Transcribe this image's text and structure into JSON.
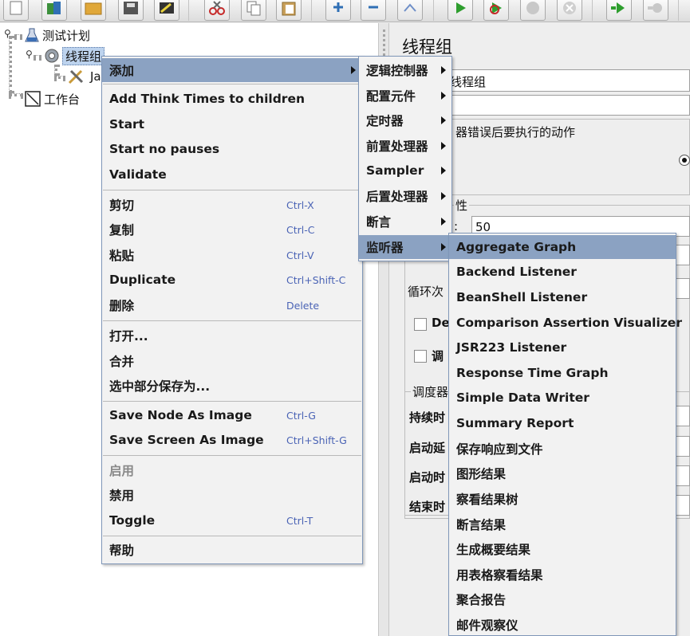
{
  "tree": {
    "root_label": "测试计划",
    "thread_group_label": "线程组",
    "child_label_partial": "Ja",
    "workbench_label": "工作台"
  },
  "right_panel": {
    "title": "线程组",
    "name_value": "线程组",
    "error_action_label": "器错误后要执行的动作",
    "props_label": "性",
    "threads_label_partial": ":",
    "threads_value": "50",
    "loop_label_partial": "循环次",
    "checkbox1_partial": "De",
    "checkbox2_partial": "调",
    "scheduler_label_partial": "调度器",
    "duration_partial": "持续时",
    "startup_delay_partial": "启动延",
    "start_time_partial": "启动时",
    "end_time_partial": "结束时"
  },
  "context_menu": {
    "items": [
      {
        "label": "添加",
        "shortcut": ""
      },
      {
        "label": "Add Think Times to children",
        "shortcut": ""
      },
      {
        "label": "Start",
        "shortcut": ""
      },
      {
        "label": "Start no pauses",
        "shortcut": ""
      },
      {
        "label": "Validate",
        "shortcut": ""
      },
      {
        "label": "剪切",
        "shortcut": "Ctrl-X"
      },
      {
        "label": "复制",
        "shortcut": "Ctrl-C"
      },
      {
        "label": "粘贴",
        "shortcut": "Ctrl-V"
      },
      {
        "label": "Duplicate",
        "shortcut": "Ctrl+Shift-C"
      },
      {
        "label": "删除",
        "shortcut": "Delete"
      },
      {
        "label": "打开...",
        "shortcut": ""
      },
      {
        "label": "合并",
        "shortcut": ""
      },
      {
        "label": "选中部分保存为...",
        "shortcut": ""
      },
      {
        "label": "Save Node As Image",
        "shortcut": "Ctrl-G"
      },
      {
        "label": "Save Screen As Image",
        "shortcut": "Ctrl+Shift-G"
      },
      {
        "label": "启用",
        "shortcut": ""
      },
      {
        "label": "禁用",
        "shortcut": ""
      },
      {
        "label": "Toggle",
        "shortcut": "Ctrl-T"
      },
      {
        "label": "帮助",
        "shortcut": ""
      }
    ]
  },
  "add_submenu": {
    "items": [
      "逻辑控制器",
      "配置元件",
      "定时器",
      "前置处理器",
      "Sampler",
      "后置处理器",
      "断言",
      "监听器"
    ]
  },
  "listener_submenu": {
    "items": [
      "Aggregate Graph",
      "Backend Listener",
      "BeanShell Listener",
      "Comparison Assertion Visualizer",
      "JSR223 Listener",
      "Response Time Graph",
      "Simple Data Writer",
      "Summary Report",
      "保存响应到文件",
      "图形结果",
      "察看结果树",
      "断言结果",
      "生成概要结果",
      "用表格察看结果",
      "聚合报告",
      "邮件观察仪"
    ]
  },
  "colors": {
    "menu_highlight": "#8ba2c2",
    "shortcut_text": "#4a63b5",
    "tree_selection": "#bdd3ee"
  }
}
